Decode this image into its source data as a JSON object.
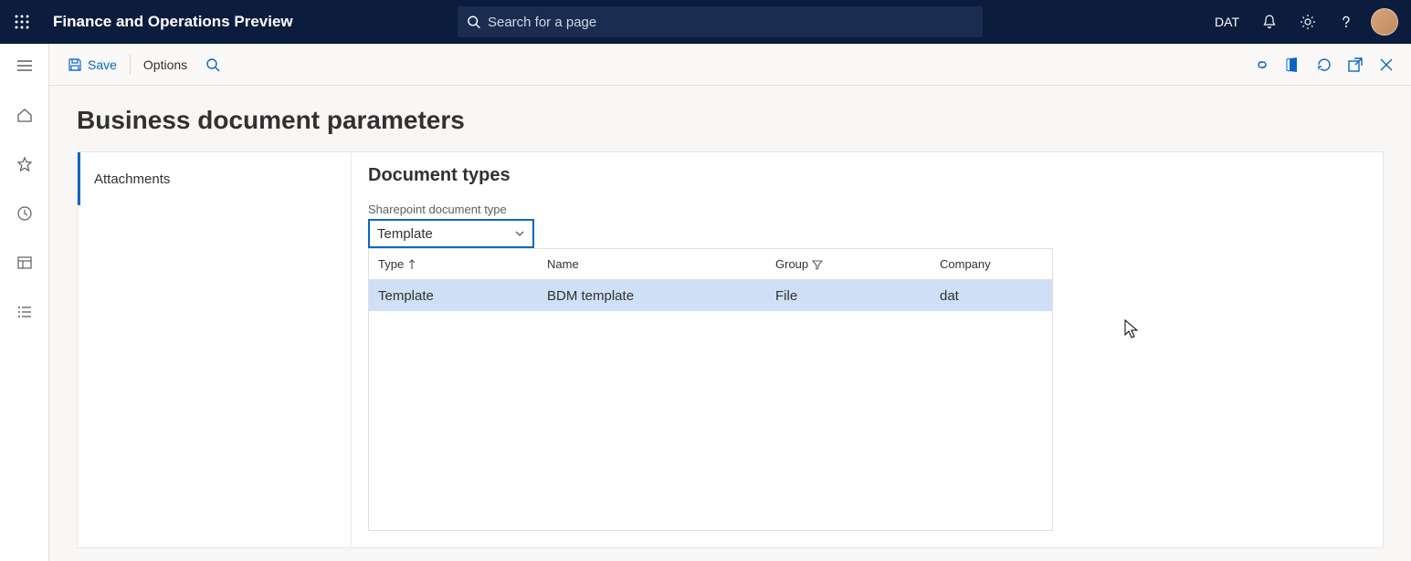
{
  "header": {
    "app_title": "Finance and Operations Preview",
    "search_placeholder": "Search for a page",
    "entity": "DAT"
  },
  "actionbar": {
    "save": "Save",
    "options": "Options"
  },
  "page": {
    "title": "Business document parameters"
  },
  "tabs": [
    {
      "label": "Attachments"
    }
  ],
  "panel": {
    "section_title": "Document types",
    "dropdown_label": "Sharepoint document type",
    "dropdown_value": "Template",
    "columns": {
      "type": "Type",
      "name": "Name",
      "group": "Group",
      "company": "Company"
    },
    "rows": [
      {
        "type": "Template",
        "name": "BDM template",
        "group": "File",
        "company": "dat"
      }
    ]
  }
}
